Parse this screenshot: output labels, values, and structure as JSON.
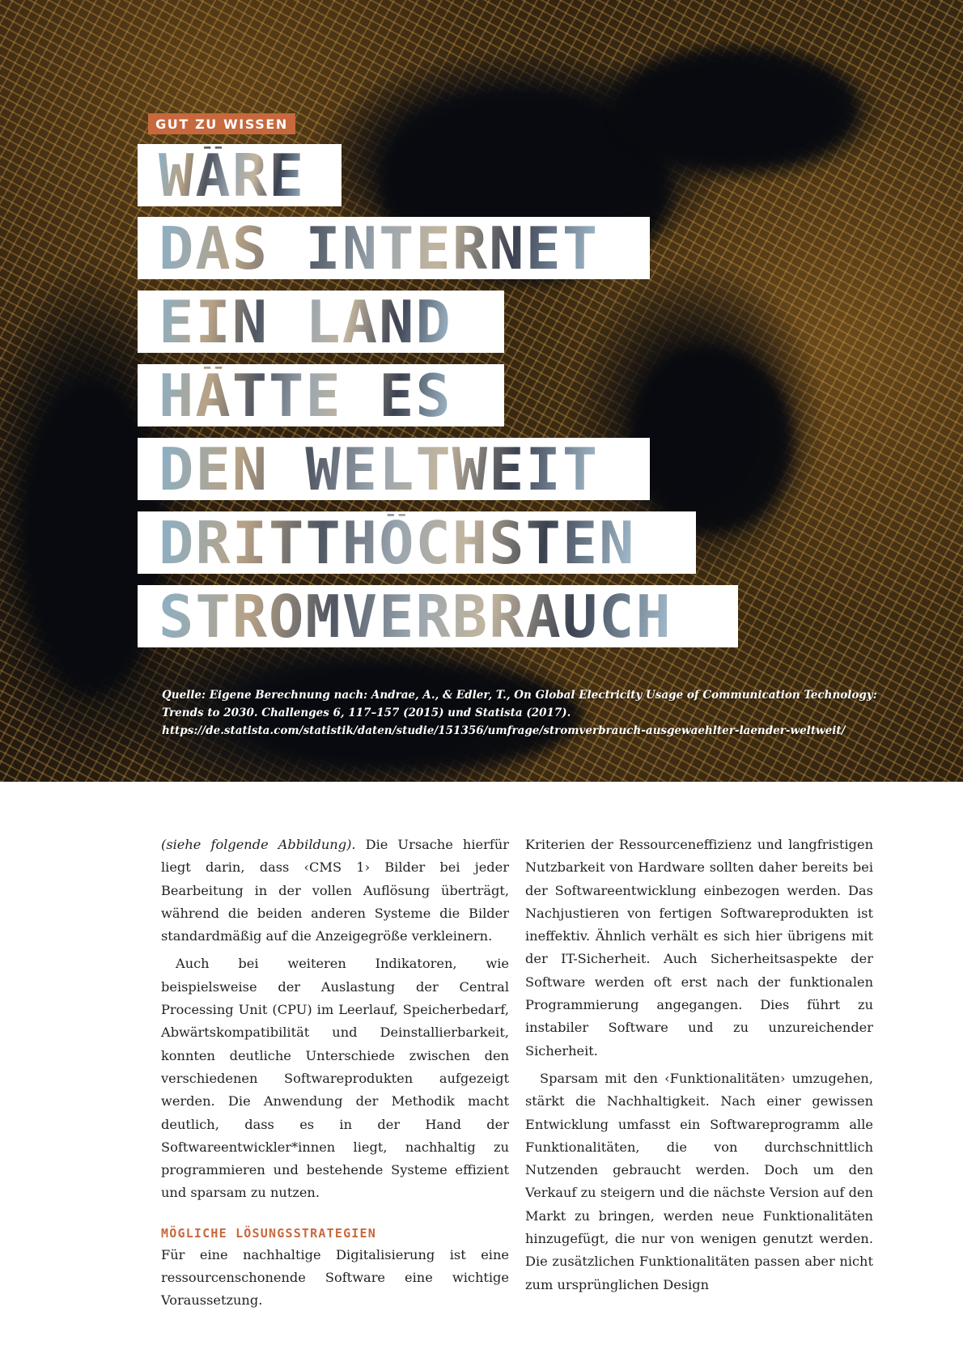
{
  "tag": "GUT ZU WISSEN",
  "headline": [
    "WÄRE",
    "DAS INTERNET",
    "EIN LAND",
    "HÄTTE ES",
    "DEN WELTWEIT",
    "DRITTHÖCHSTEN",
    "STROMVERBRAUCH"
  ],
  "source": [
    "Quelle: Eigene Berechnung nach: Andrae, A., & Edler, T., On Global Electricity Usage of Communication Technology:",
    "Trends to 2030. Challenges 6, 117–157 (2015) und Statista (2017).",
    "https://de.statista.com/statistik/daten/studie/151356/umfrage/stromverbrauch-ausgewaehlter-laender-weltweit/"
  ],
  "left_column": {
    "p1_italic": "(siehe folgende Abbildung).",
    "p1_rest": " Die Ursache hierfür liegt darin, dass ‹CMS 1› Bilder bei jeder Bearbeitung in der vollen Auflösung überträgt, während die beiden anderen Systeme die Bilder standardmäßig auf die Anzeigegröße verkleinern.",
    "p2": "Auch bei weiteren Indikatoren, wie beispielsweise der Auslastung der Central Processing Unit (CPU) im Leerlauf, Speicherbedarf, Abwärtskompatibilität und Deinstallierbarkeit, konnten deutliche Unterschiede zwischen den verschiedenen Softwareprodukten aufgezeigt werden. Die Anwendung der Methodik macht deutlich, dass es in der Hand der Softwareentwickler*innen liegt, nachhaltig zu programmieren und bestehende Systeme effizient und sparsam zu nutzen.",
    "subhead": "MÖGLICHE LÖSUNGSSTRATEGIEN",
    "p3": "Für eine nachhaltige Digitalisierung ist eine ressourcenschonende Software eine wichtige Voraussetzung."
  },
  "right_column": {
    "p1": "Kriterien der Ressourceneffizienz und langfristigen Nutzbarkeit von Hardware sollten daher bereits bei der Softwareentwicklung einbezogen werden. Das Nachjustieren von fertigen Softwareprodukten ist ineffektiv. Ähnlich verhält es sich hier übrigens mit der IT-Sicherheit. Auch Sicherheitsaspekte der Software werden oft erst nach der funktionalen Programmierung angegangen. Dies führt zu instabiler Software und zu unzureichender Sicherheit.",
    "p2": "Sparsam mit den ‹Funktionalitäten› umzugehen, stärkt die Nachhaltigkeit. Nach einer gewissen Entwicklung umfasst ein Softwareprogramm alle Funktionalitäten, die von durchschnittlich Nutzenden gebraucht werden. Doch um den Verkauf zu steigern und die nächste Version auf den Markt zu bringen, werden neue Funktionalitäten hinzugefügt, die nur von wenigen genutzt werden. Die zusätzlichen Funktionalitäten passen aber nicht zum ursprünglichen Design"
  },
  "colors": {
    "accent": "#c8683d",
    "text": "#231f20"
  }
}
